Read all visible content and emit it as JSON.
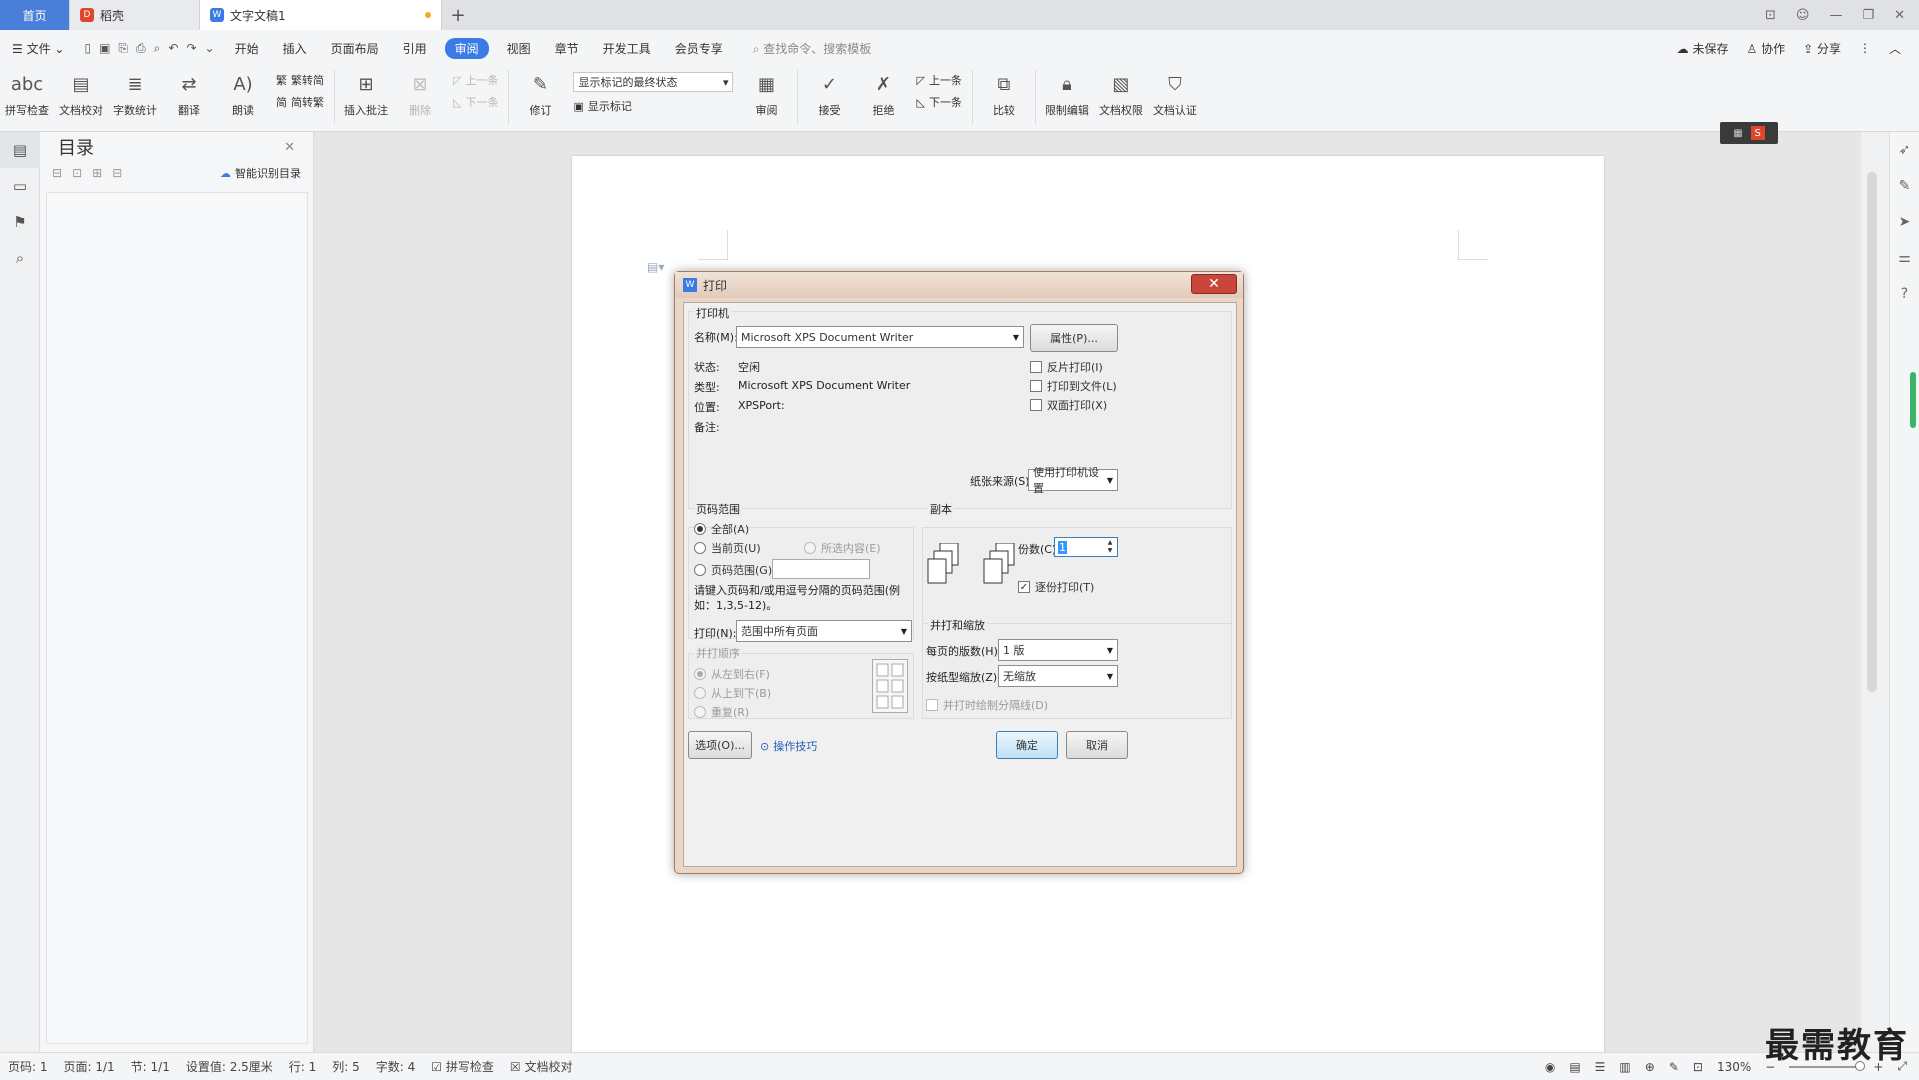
{
  "tabs": {
    "home": "首页",
    "shell": "稻壳",
    "doc": "文字文稿1",
    "add": "+"
  },
  "menu": {
    "file": "文件",
    "items": [
      "开始",
      "插入",
      "页面布局",
      "引用",
      "审阅",
      "视图",
      "章节",
      "开发工具",
      "会员专享"
    ],
    "active": "审阅",
    "search": "查找命令、搜索模板",
    "unsaved": "未保存",
    "collab": "协作",
    "share": "分享"
  },
  "ribbon": {
    "spell": "拼写检查",
    "proof": "文档校对",
    "wordcount": "字数统计",
    "translate": "翻译",
    "read": "朗读",
    "trad2simp": "繁转简",
    "simp2trad": "简转繁",
    "insert_comment": "插入批注",
    "delete": "删除",
    "prev": "上一条",
    "next": "下一条",
    "revise": "修订",
    "markup_select": "显示标记的最终状态",
    "show_markup": "显示标记",
    "review": "审阅",
    "accept": "接受",
    "reject": "拒绝",
    "prev2": "上一条",
    "next2": "下一条",
    "compare": "比较",
    "restrict": "限制编辑",
    "permission": "文档权限",
    "certify": "文档认证"
  },
  "toc": {
    "title": "目录",
    "smart": "智能识别目录"
  },
  "dialog": {
    "title": "打印",
    "close": "✕",
    "printer_group": "打印机",
    "name_label": "名称(M):",
    "name_value": "Microsoft XPS Document Writer",
    "properties": "属性(P)...",
    "status_label": "状态:",
    "status_value": "空闲",
    "type_label": "类型:",
    "type_value": "Microsoft XPS Document Writer",
    "where_label": "位置:",
    "where_value": "XPSPort:",
    "comment_label": "备注:",
    "reverse": "反片打印(I)",
    "to_file": "打印到文件(L)",
    "duplex": "双面打印(X)",
    "source_label": "纸张来源(S):",
    "source_value": "使用打印机设置",
    "range_group": "页码范围",
    "all": "全部(A)",
    "current": "当前页(U)",
    "selection": "所选内容(E)",
    "pages": "页码范围(G):",
    "pages_hint": "请键入页码和/或用逗号分隔的页码范围(例如：1,3,5-12)。",
    "copies_group": "副本",
    "copies_label": "份数(C):",
    "copies_value": "1",
    "collate": "逐份打印(T)",
    "print_label": "打印(N):",
    "print_value": "范围中所有页面",
    "order_group": "并打顺序",
    "ltr": "从左到右(F)",
    "ttb": "从上到下(B)",
    "repeat": "重复(R)",
    "zoom_group": "并打和缩放",
    "per_sheet_label": "每页的版数(H):",
    "per_sheet_value": "1 版",
    "scale_label": "按纸型缩放(Z):",
    "scale_value": "无缩放",
    "draw_lines": "并打时绘制分隔线(D)",
    "options": "选项(O)...",
    "tips": "操作技巧",
    "ok": "确定",
    "cancel": "取消"
  },
  "status": {
    "page": "页码: 1",
    "pages": "页面: 1/1",
    "section": "节: 1/1",
    "setting": "设置值: 2.5厘米",
    "row": "行: 1",
    "col": "列: 5",
    "words": "字数: 4",
    "spell": "拼写检查",
    "proof": "文档校对",
    "zoom": "130%"
  },
  "watermark": "最需教育",
  "colors": {
    "accent": "#3b7be6",
    "home_tab": "#4a7fd9",
    "dialog_close": "#c9463b"
  }
}
